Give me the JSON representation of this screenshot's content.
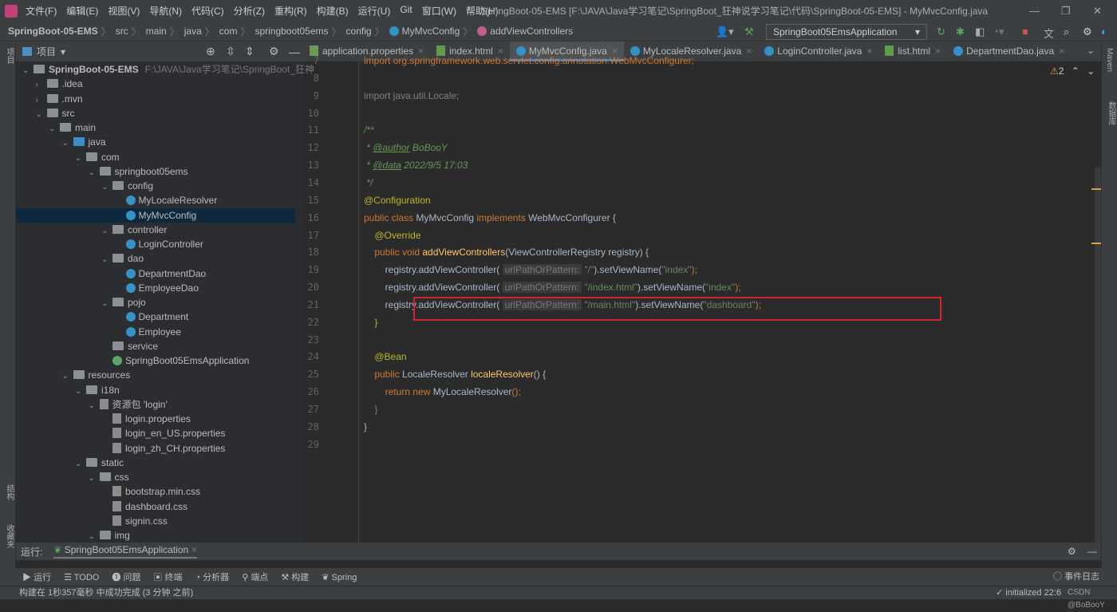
{
  "menu": {
    "items": [
      "文件(F)",
      "编辑(E)",
      "视图(V)",
      "导航(N)",
      "代码(C)",
      "分析(Z)",
      "重构(R)",
      "构建(B)",
      "运行(U)",
      "Git",
      "窗口(W)",
      "帮助(H)"
    ],
    "title": "SpringBoot-05-EMS [F:\\JAVA\\Java学习笔记\\SpringBoot_狂神说学习笔记\\代码\\SpringBoot-05-EMS] - MyMvcConfig.java"
  },
  "breadcrumb": [
    "SpringBoot-05-EMS",
    "src",
    "main",
    "java",
    "com",
    "springboot05ems",
    "config",
    "MyMvcConfig",
    "addViewControllers"
  ],
  "run_config": "SpringBoot05EmsApplication",
  "project": {
    "label": "项目",
    "root_path": "F:\\JAVA\\Java学习笔记\\SpringBoot_狂神",
    "tree": [
      {
        "d": 0,
        "t": "SpringBoot-05-EMS",
        "ex": "v",
        "k": "root"
      },
      {
        "d": 1,
        "t": ".idea",
        "ex": ">",
        "k": "folder"
      },
      {
        "d": 1,
        "t": ".mvn",
        "ex": ">",
        "k": "folder"
      },
      {
        "d": 1,
        "t": "src",
        "ex": "v",
        "k": "folder"
      },
      {
        "d": 2,
        "t": "main",
        "ex": "v",
        "k": "folder"
      },
      {
        "d": 3,
        "t": "java",
        "ex": "v",
        "k": "blue"
      },
      {
        "d": 4,
        "t": "com",
        "ex": "v",
        "k": "pkg"
      },
      {
        "d": 5,
        "t": "springboot05ems",
        "ex": "v",
        "k": "pkg"
      },
      {
        "d": 6,
        "t": "config",
        "ex": "v",
        "k": "pkg"
      },
      {
        "d": 7,
        "t": "MyLocaleResolver",
        "ex": "",
        "k": "class"
      },
      {
        "d": 7,
        "t": "MyMvcConfig",
        "ex": "",
        "k": "class",
        "sel": true
      },
      {
        "d": 6,
        "t": "controller",
        "ex": "v",
        "k": "pkg"
      },
      {
        "d": 7,
        "t": "LoginController",
        "ex": "",
        "k": "class"
      },
      {
        "d": 6,
        "t": "dao",
        "ex": "v",
        "k": "pkg"
      },
      {
        "d": 7,
        "t": "DepartmentDao",
        "ex": "",
        "k": "class"
      },
      {
        "d": 7,
        "t": "EmployeeDao",
        "ex": "",
        "k": "class"
      },
      {
        "d": 6,
        "t": "pojo",
        "ex": "v",
        "k": "pkg"
      },
      {
        "d": 7,
        "t": "Department",
        "ex": "",
        "k": "class"
      },
      {
        "d": 7,
        "t": "Employee",
        "ex": "",
        "k": "class"
      },
      {
        "d": 6,
        "t": "service",
        "ex": "",
        "k": "pkg"
      },
      {
        "d": 6,
        "t": "SpringBoot05EmsApplication",
        "ex": "",
        "k": "app"
      },
      {
        "d": 3,
        "t": "resources",
        "ex": "v",
        "k": "folder"
      },
      {
        "d": 4,
        "t": "i18n",
        "ex": "v",
        "k": "folder"
      },
      {
        "d": 5,
        "t": "资源包 'login'",
        "ex": "v",
        "k": "file"
      },
      {
        "d": 6,
        "t": "login.properties",
        "ex": "",
        "k": "file"
      },
      {
        "d": 6,
        "t": "login_en_US.properties",
        "ex": "",
        "k": "file"
      },
      {
        "d": 6,
        "t": "login_zh_CH.properties",
        "ex": "",
        "k": "file"
      },
      {
        "d": 4,
        "t": "static",
        "ex": "v",
        "k": "folder"
      },
      {
        "d": 5,
        "t": "css",
        "ex": "v",
        "k": "folder"
      },
      {
        "d": 6,
        "t": "bootstrap.min.css",
        "ex": "",
        "k": "file"
      },
      {
        "d": 6,
        "t": "dashboard.css",
        "ex": "",
        "k": "file"
      },
      {
        "d": 6,
        "t": "signin.css",
        "ex": "",
        "k": "file"
      },
      {
        "d": 5,
        "t": "img",
        "ex": "v",
        "k": "folder"
      }
    ]
  },
  "tabs": [
    {
      "label": "application.properties"
    },
    {
      "label": "index.html"
    },
    {
      "label": "MyMvcConfig.java",
      "active": true
    },
    {
      "label": "MyLocaleResolver.java"
    },
    {
      "label": "LoginController.java"
    },
    {
      "label": "list.html"
    },
    {
      "label": "DepartmentDao.java"
    }
  ],
  "editor": {
    "warnings": "2",
    "lines": [
      {
        "n": "7",
        "tok": [
          [
            "import org.springframework.web.servlet.config.annotation.WebMvcConfigurer;",
            "k"
          ]
        ]
      },
      {
        "n": "8",
        "tok": []
      },
      {
        "n": "9",
        "tok": [
          [
            "import java.util.Locale;",
            "g"
          ]
        ]
      },
      {
        "n": "10",
        "tok": []
      },
      {
        "n": "11",
        "tok": [
          [
            "/**",
            "c"
          ]
        ]
      },
      {
        "n": "12",
        "tok": [
          [
            " * ",
            "c"
          ],
          [
            "@author",
            "ct"
          ],
          [
            " BoBooY",
            "c"
          ]
        ]
      },
      {
        "n": "13",
        "tok": [
          [
            " * ",
            "c"
          ],
          [
            "@data",
            "ct"
          ],
          [
            " 2022/9/5 17:03",
            "c"
          ]
        ]
      },
      {
        "n": "14",
        "tok": [
          [
            " */",
            "c"
          ]
        ]
      },
      {
        "n": "15",
        "tok": [
          [
            "@Configuration",
            "a"
          ]
        ]
      },
      {
        "n": "16",
        "tok": [
          [
            "public class ",
            "k"
          ],
          [
            "MyMvcConfig ",
            "p"
          ],
          [
            "implements ",
            "k"
          ],
          [
            "WebMvcConfigurer {",
            "p"
          ]
        ]
      },
      {
        "n": "17",
        "tok": [
          [
            "    @Override",
            "a"
          ]
        ]
      },
      {
        "n": "18",
        "tok": [
          [
            "    public void ",
            "k"
          ],
          [
            "addViewControllers",
            "f"
          ],
          [
            "(ViewControllerRegistry registry) {",
            "p"
          ]
        ]
      },
      {
        "n": "19",
        "tok": [
          [
            "        registry.addViewController( ",
            "p"
          ],
          [
            "urlPathOrPattern:",
            "h"
          ],
          [
            " \"/\"",
            "s"
          ],
          [
            ").setViewName(",
            "p"
          ],
          [
            "\"index\"",
            "s"
          ],
          [
            ");",
            "k"
          ]
        ]
      },
      {
        "n": "20",
        "tok": [
          [
            "        registry.addViewController( ",
            "p"
          ],
          [
            "urlPathOrPattern:",
            "h"
          ],
          [
            " \"/index.html\"",
            "s"
          ],
          [
            ").setViewName(",
            "p"
          ],
          [
            "\"index\"",
            "s"
          ],
          [
            ");",
            "k"
          ]
        ]
      },
      {
        "n": "21",
        "tok": [
          [
            "        registry.addViewController( ",
            "p"
          ],
          [
            "urlPathOrPattern:",
            "h"
          ],
          [
            " \"/main.html\"",
            "s"
          ],
          [
            ").setViewName(",
            "p"
          ],
          [
            "\"dashboard\"",
            "s"
          ],
          [
            ");",
            "k"
          ]
        ]
      },
      {
        "n": "22",
        "tok": [
          [
            "    }",
            "a"
          ]
        ]
      },
      {
        "n": "23",
        "tok": []
      },
      {
        "n": "24",
        "tok": [
          [
            "    @Bean",
            "a"
          ]
        ]
      },
      {
        "n": "25",
        "tok": [
          [
            "    public ",
            "k"
          ],
          [
            "LocaleResolver ",
            "p"
          ],
          [
            "localeResolver",
            "f"
          ],
          [
            "() {",
            "p"
          ]
        ]
      },
      {
        "n": "26",
        "tok": [
          [
            "        return new ",
            "k"
          ],
          [
            "MyLocaleResolver",
            "p"
          ],
          [
            "();",
            "k"
          ]
        ]
      },
      {
        "n": "27",
        "tok": [
          [
            "    }",
            "s"
          ]
        ]
      },
      {
        "n": "28",
        "tok": [
          [
            "}",
            "p"
          ]
        ]
      },
      {
        "n": "29",
        "tok": []
      }
    ]
  },
  "run": {
    "label": "运行:",
    "app": "SpringBoot05EmsApplication"
  },
  "toolwindows": [
    "运行",
    "TODO",
    "问题",
    "终端",
    "分析器",
    "端点",
    "构建",
    "Spring"
  ],
  "right_strip": [
    "Maven",
    "数据库"
  ],
  "left_strip": [
    "项目",
    "结构",
    "收藏夹"
  ],
  "status": {
    "message": "构建在 1秒357毫秒 中成功完成 (3 分钟 之前)",
    "event_log": "事件日志",
    "right": "initialized",
    "pos": "22:6",
    "watermark": "CSDN @BoBooY"
  }
}
